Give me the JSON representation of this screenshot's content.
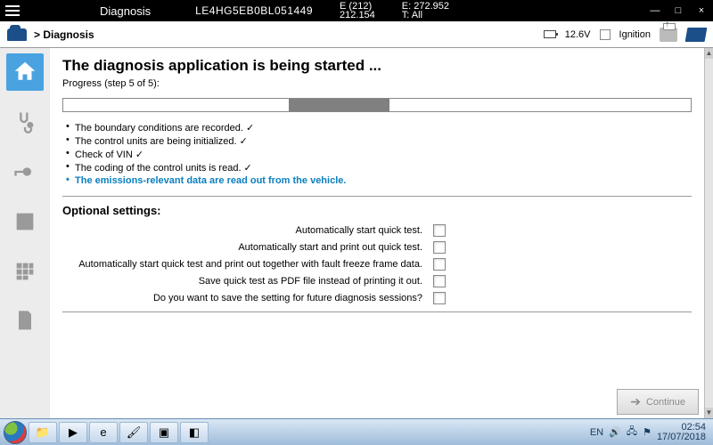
{
  "topbar": {
    "title": "Diagnosis",
    "vin": "LE4HG5EB0BL051449",
    "group1_top": "E (212)",
    "group1_bot": "212.154",
    "group2_top": "E: 272.952",
    "group2_bot": "T: All"
  },
  "crumb": {
    "text": "> Diagnosis",
    "voltage": "12.6V",
    "ignition_label": "Ignition"
  },
  "main": {
    "heading": "The diagnosis application is being started ...",
    "progress_label": "Progress (step 5 of 5):",
    "steps": [
      {
        "text": "The boundary conditions are recorded. ✓",
        "current": false
      },
      {
        "text": "The control units are being initialized. ✓",
        "current": false
      },
      {
        "text": "Check of VIN ✓",
        "current": false
      },
      {
        "text": "The coding of the control units is read. ✓",
        "current": false
      },
      {
        "text": "The emissions-relevant data are read out from the vehicle.",
        "current": true
      }
    ],
    "optional_heading": "Optional settings:",
    "options": [
      "Automatically start quick test.",
      "Automatically start and print out quick test.",
      "Automatically start quick test and print out together with fault freeze frame data.",
      "Save quick test as PDF file instead of printing it out.",
      "Do you want to save the setting for future diagnosis sessions?"
    ],
    "continue_label": "Continue"
  },
  "taskbar": {
    "lang": "EN",
    "time": "02:54",
    "date": "17/07/2018"
  }
}
